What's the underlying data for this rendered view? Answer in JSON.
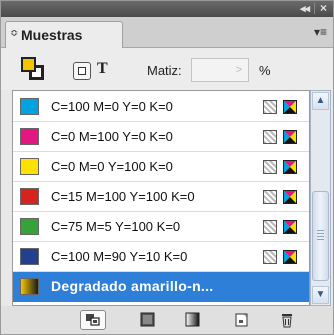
{
  "window": {
    "collapse_glyph": "◂◂",
    "close_glyph": "×"
  },
  "tab": {
    "label": "Muestras",
    "arrows_glyph": "≎",
    "menu_glyph": "▾≡"
  },
  "controls": {
    "text_button_label": "T",
    "matiz_label": "Matiz:",
    "matiz_value": "",
    "matiz_arrow": ">",
    "percent_label": "%",
    "fill_color": "#f3c500",
    "stroke_color": "#222222"
  },
  "swatches": [
    {
      "name": "C=100 M=0 Y=0 K=0",
      "color": "#00a3e0"
    },
    {
      "name": "C=0 M=100 Y=0 K=0",
      "color": "#e2177f"
    },
    {
      "name": "C=0 M=0 Y=100 K=0",
      "color": "#fde100"
    },
    {
      "name": "C=15 M=100 Y=100 K=0",
      "color": "#d6231e"
    },
    {
      "name": "C=75 M=5 Y=100 K=0",
      "color": "#35a33a"
    },
    {
      "name": "C=100 M=90 Y=10 K=0",
      "color": "#23408f"
    },
    {
      "name": "Degradado amarillo-n...",
      "color": "gradient-yellow-black",
      "selected": true
    }
  ],
  "scrollbar": {
    "up_glyph": "▲",
    "down_glyph": "▼"
  },
  "bottom_buttons": [
    {
      "icon": "show-all-swatches-icon"
    },
    {
      "icon": "show-color-swatches-icon"
    },
    {
      "icon": "show-gradient-swatches-icon"
    },
    {
      "icon": "new-swatch-icon"
    },
    {
      "icon": "delete-swatch-icon"
    }
  ]
}
